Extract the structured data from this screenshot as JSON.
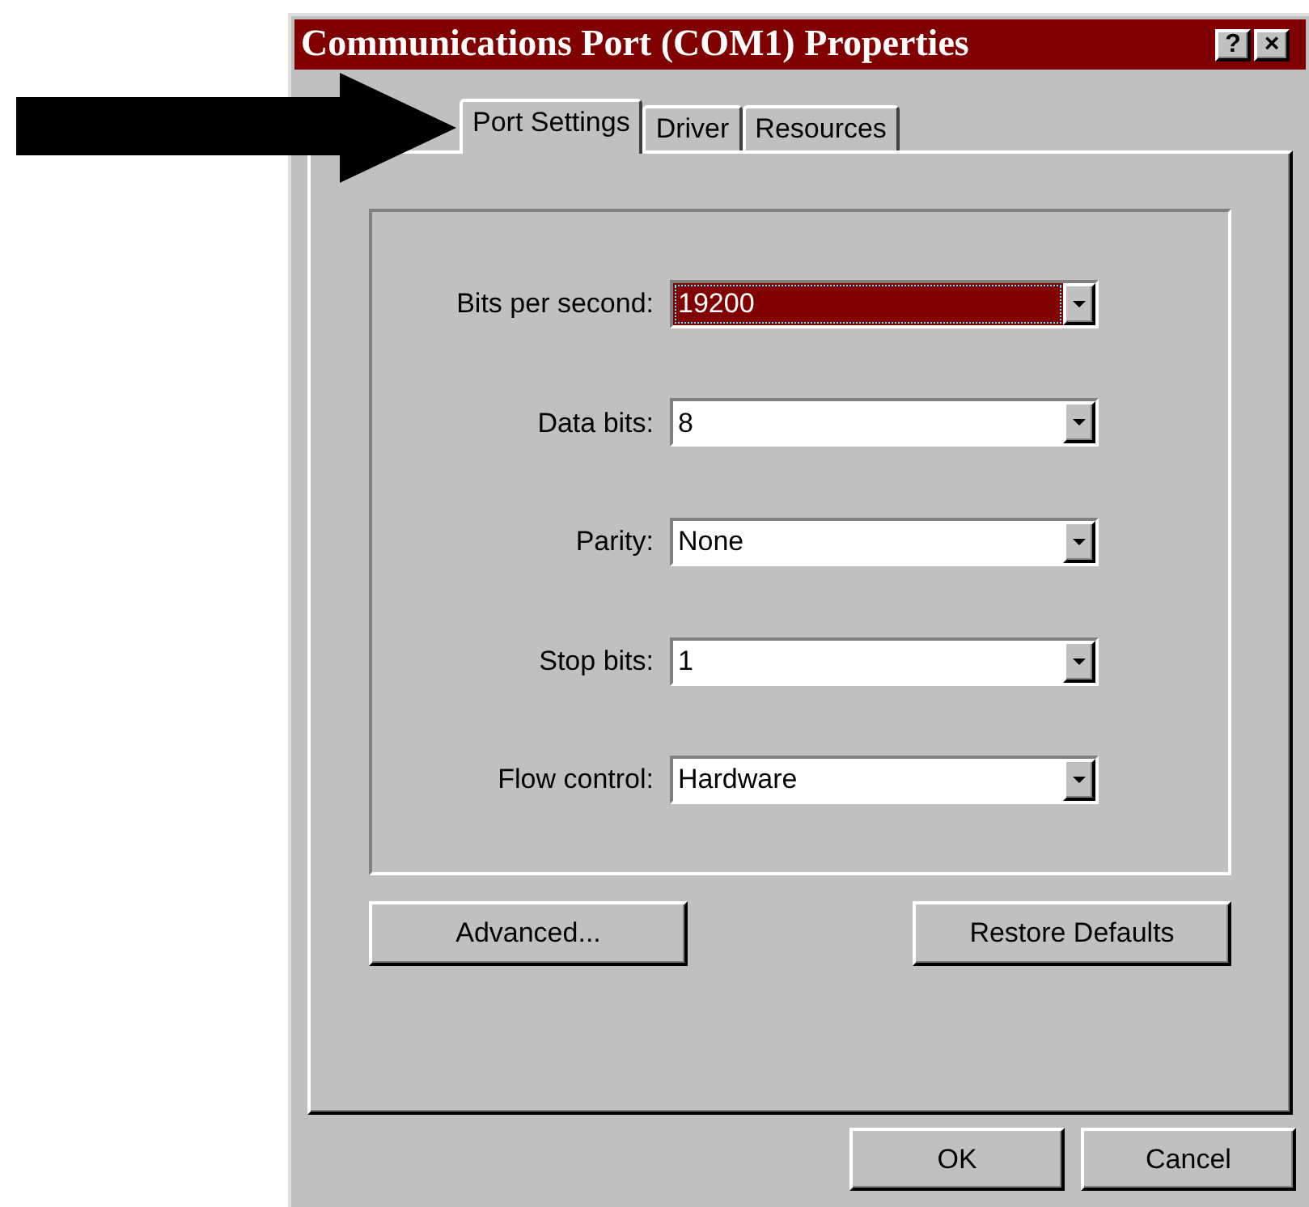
{
  "window": {
    "title": "Communications Port (COM1) Properties",
    "title_buttons": [
      "?",
      "×"
    ]
  },
  "tabs": [
    {
      "label": "Port Settings",
      "selected": true
    },
    {
      "label": "Driver",
      "selected": false
    },
    {
      "label": "Resources",
      "selected": false
    }
  ],
  "settings": [
    {
      "label": "Bits per second:",
      "value": "19200",
      "focused": true
    },
    {
      "label": "Data bits:",
      "value": "8",
      "focused": false
    },
    {
      "label": "Parity:",
      "value": "None",
      "focused": false
    },
    {
      "label": "Stop bits:",
      "value": "1",
      "focused": false
    },
    {
      "label": "Flow control:",
      "value": "Hardware",
      "focused": false
    }
  ],
  "panel_buttons": [
    "Advanced...",
    "Restore Defaults"
  ],
  "dialog_buttons": [
    "OK",
    "Cancel"
  ]
}
